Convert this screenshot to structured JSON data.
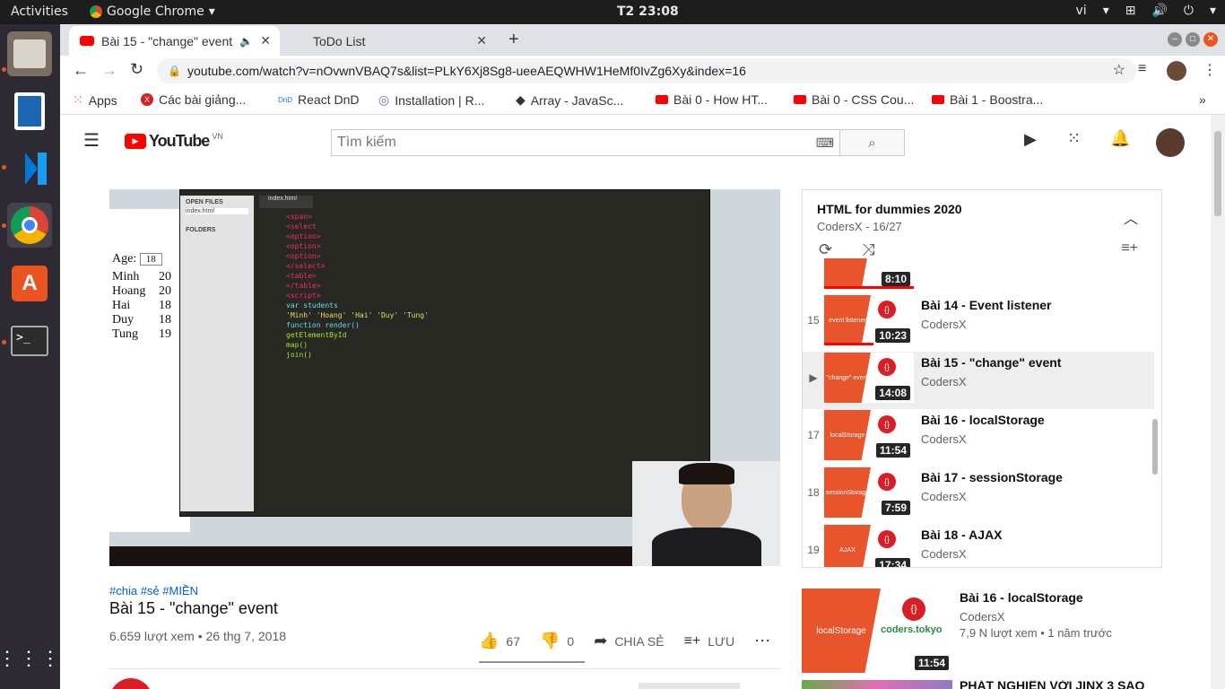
{
  "topbar": {
    "activities": "Activities",
    "app": "Google Chrome",
    "clock": "T2 23:08",
    "lang": "vi"
  },
  "tabs": [
    {
      "label": "Bài 15 - \"change\" event"
    },
    {
      "label": "ToDo List"
    }
  ],
  "omnibox": {
    "url": "youtube.com/watch?v=nOvwnVBAQ7s&list=PLkY6Xj8Sg8-ueeAEQWHW1HeMf0IvZg6Xy&index=16"
  },
  "bookmarks": [
    {
      "label": "Apps"
    },
    {
      "label": "Các bài giảng..."
    },
    {
      "label": "React DnD"
    },
    {
      "label": "Installation | R..."
    },
    {
      "label": "Array - JavaSc..."
    },
    {
      "label": "Bài 0 - How HT..."
    },
    {
      "label": "Bài 0 - CSS Cou..."
    },
    {
      "label": "Bài 1 - Boostra..."
    }
  ],
  "yt": {
    "logo": "YouTube",
    "region": "VN",
    "search_placeholder": "Tìm kiếm"
  },
  "video": {
    "tags": "#chia #sẻ #MIỀN",
    "title": "Bài 15 - \"change\" event",
    "views": "6.659 lượt xem • 26 thg 7, 2018",
    "likes": "67",
    "dislikes": "0",
    "share": "CHIA SẺ",
    "save": "LƯU",
    "editor_tab": "index.html",
    "open_files": "OPEN FILES",
    "folders": "FOLDERS",
    "age_label": "Age:",
    "age_value": "18",
    "table": [
      [
        "Minh",
        "20"
      ],
      [
        "Hoang",
        "20"
      ],
      [
        "Hai",
        "18"
      ],
      [
        "Duy",
        "18"
      ],
      [
        "Tung",
        "19"
      ]
    ]
  },
  "playlist": {
    "title": "HTML for dummies 2020",
    "meta": "CodersX - 16/27",
    "items": [
      {
        "num": "",
        "title": "",
        "channel": "",
        "dur": "8:10",
        "thumb": ""
      },
      {
        "num": "15",
        "title": "Bài 14 - Event listener",
        "channel": "CodersX",
        "dur": "10:23",
        "thumb": "event listener"
      },
      {
        "num": "▶",
        "title": "Bài 15 - \"change\" event",
        "channel": "CodersX",
        "dur": "14:08",
        "thumb": "\"change\" event"
      },
      {
        "num": "17",
        "title": "Bài 16 - localStorage",
        "channel": "CodersX",
        "dur": "11:54",
        "thumb": "localStorage"
      },
      {
        "num": "18",
        "title": "Bài 17 - sessionStorage",
        "channel": "CodersX",
        "dur": "7:59",
        "thumb": "sessionStorage"
      },
      {
        "num": "19",
        "title": "Bài 18 - AJAX",
        "channel": "CodersX",
        "dur": "17:34",
        "thumb": "AJAX"
      }
    ]
  },
  "recommended": [
    {
      "title": "Bài 16 - localStorage",
      "channel": "CodersX",
      "meta": "7,9 N lượt xem • 1 năm trước",
      "dur": "11:54",
      "thumb": "localStorage",
      "brand": "coders.tokyo"
    },
    {
      "title": "PHÁT NGHIỆN VỚI JINX 3 SAO"
    }
  ],
  "colors": {
    "yt_red": "#ff0000",
    "ubuntu_orange": "#e95420",
    "accent": "#e8552c"
  }
}
